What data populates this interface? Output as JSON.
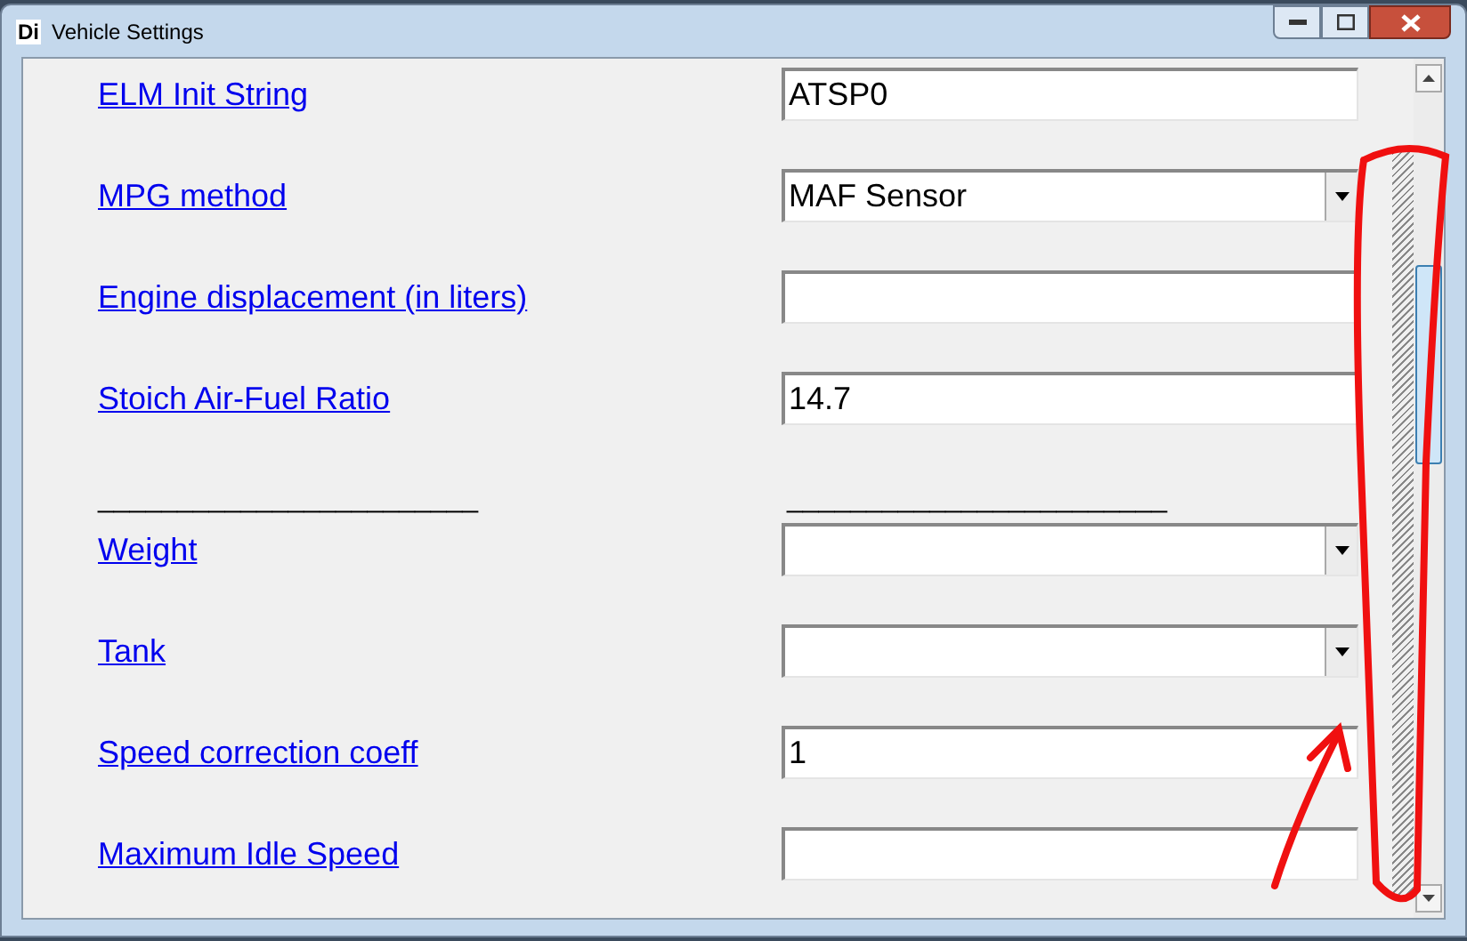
{
  "window": {
    "logo": "Di",
    "title": "Vehicle Settings"
  },
  "rows": [
    {
      "kind": "text_field",
      "label": "ELM Init String",
      "value": "ATSP0"
    },
    {
      "kind": "dropdown",
      "label": "MPG method",
      "value": "MAF Sensor"
    },
    {
      "kind": "text_field",
      "label": "Engine displacement (in liters)"
    },
    {
      "kind": "text_field",
      "label": "Stoich Air-Fuel Ratio",
      "value": "14.7"
    },
    {
      "kind": "separator",
      "left": "________________________",
      "right": "________________________"
    },
    {
      "kind": "dropdown",
      "label": "Weight"
    },
    {
      "kind": "dropdown",
      "label": "Tank"
    },
    {
      "kind": "text_field",
      "label": "Speed correction coeff",
      "value": "1"
    },
    {
      "kind": "text_field",
      "label": "Maximum Idle Speed"
    }
  ]
}
